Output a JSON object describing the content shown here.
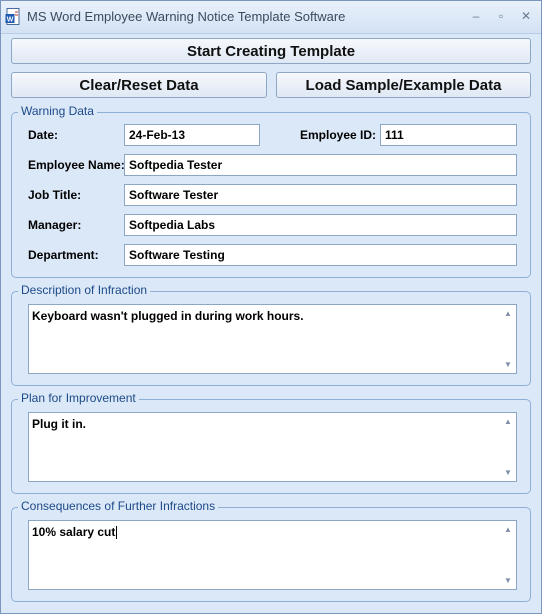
{
  "window": {
    "title": "MS Word Employee Warning Notice Template Software",
    "controls": {
      "minimize": "–",
      "maximize": "▫",
      "close": "✕"
    }
  },
  "toolbar": {
    "start_label": "Start Creating Template",
    "clear_label": "Clear/Reset Data",
    "load_label": "Load Sample/Example Data"
  },
  "warning_data": {
    "legend": "Warning Data",
    "date_label": "Date:",
    "date_value": "24-Feb-13",
    "employee_id_label": "Employee ID:",
    "employee_id_value": "111",
    "employee_name_label": "Employee Name:",
    "employee_name_value": "Softpedia Tester",
    "job_title_label": "Job Title:",
    "job_title_value": "Software Tester",
    "manager_label": "Manager:",
    "manager_value": "Softpedia Labs",
    "department_label": "Department:",
    "department_value": "Software Testing"
  },
  "infraction": {
    "legend": "Description of Infraction",
    "text": "Keyboard wasn't plugged in during work hours."
  },
  "improvement": {
    "legend": "Plan for Improvement",
    "text": "Plug it in."
  },
  "consequences": {
    "legend": "Consequences of Further Infractions",
    "text": "10% salary cut"
  },
  "colors": {
    "background": "#dbe8f7",
    "legend_text": "#1d4a8a",
    "border": "#8eafd6"
  }
}
